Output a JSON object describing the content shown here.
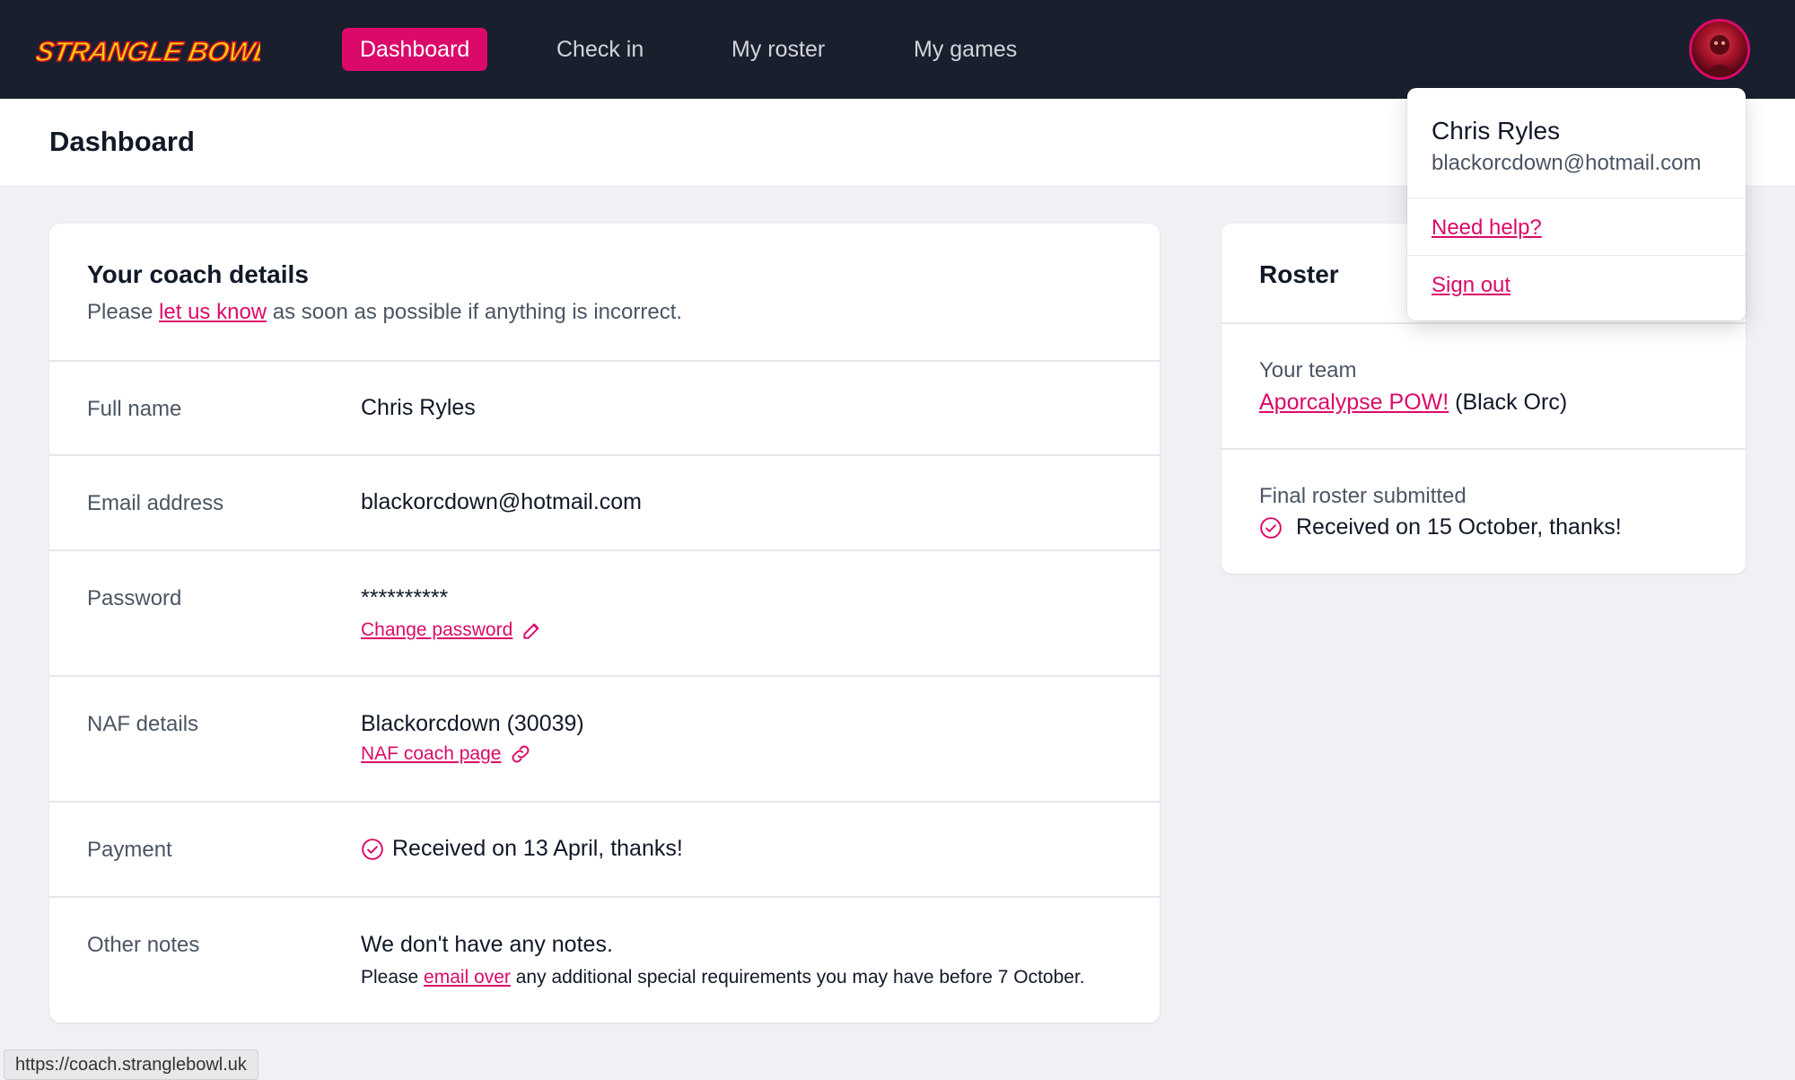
{
  "brand": {
    "name": "STRANGLE BOWL",
    "accent": "#db0a6a",
    "logo_color": "#f5d000"
  },
  "nav": {
    "items": [
      {
        "label": "Dashboard",
        "active": true
      },
      {
        "label": "Check in",
        "active": false
      },
      {
        "label": "My roster",
        "active": false
      },
      {
        "label": "My games",
        "active": false
      }
    ]
  },
  "header": {
    "title": "Dashboard"
  },
  "user_menu": {
    "name": "Chris Ryles",
    "email": "blackorcdown@hotmail.com",
    "help_label": "Need help?",
    "signout_label": "Sign out"
  },
  "coach": {
    "title": "Your coach details",
    "subtitle_before": "Please ",
    "subtitle_link": "let us know",
    "subtitle_after": " as soon as possible if anything is incorrect.",
    "rows": {
      "full_name": {
        "label": "Full name",
        "value": "Chris Ryles"
      },
      "email": {
        "label": "Email address",
        "value": "blackorcdown@hotmail.com"
      },
      "password": {
        "label": "Password",
        "value": "**********",
        "link": "Change password"
      },
      "naf": {
        "label": "NAF details",
        "value": "Blackorcdown (30039)",
        "link": "NAF coach page"
      },
      "payment": {
        "label": "Payment",
        "value": "Received on 13 April, thanks!"
      },
      "notes": {
        "label": "Other notes",
        "value": "We don't have any notes.",
        "line_before": "Please ",
        "line_link": "email over",
        "line_after": " any additional special requirements you may have before 7 October."
      }
    }
  },
  "roster": {
    "title": "Roster",
    "team_label": "Your team",
    "team_name": "Aporcalypse POW!",
    "team_race": "(Black Orc)",
    "final_label": "Final roster submitted",
    "final_value": "Received on 15 October, thanks!"
  },
  "status_bar": {
    "url": "https://coach.stranglebowl.uk"
  }
}
